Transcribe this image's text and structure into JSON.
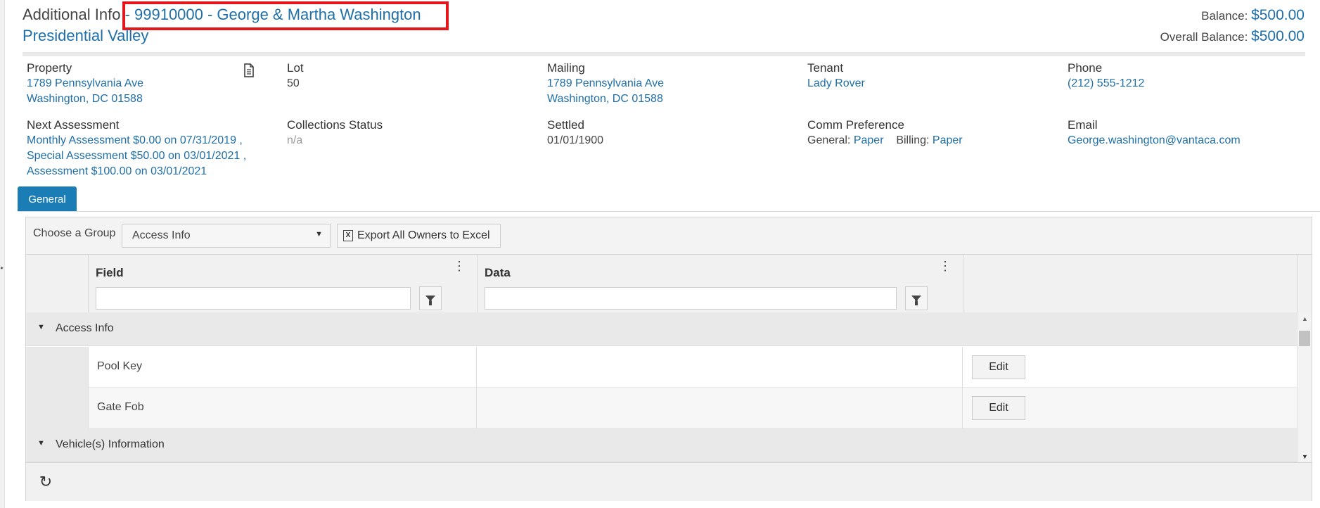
{
  "header": {
    "title_prefix": "Additional Info",
    "owner": "- 99910000 - George & Martha Washington",
    "community": "Presidential Valley",
    "balance_label": "Balance:",
    "balance_value": "$500.00",
    "overall_label": "Overall Balance:",
    "overall_value": "$500.00"
  },
  "info": {
    "property": {
      "label": "Property",
      "line1": "1789 Pennsylvania Ave",
      "line2": "Washington, DC 01588"
    },
    "lot": {
      "label": "Lot",
      "value": "50"
    },
    "mailing": {
      "label": "Mailing",
      "line1": "1789 Pennsylvania Ave",
      "line2": "Washington, DC 01588"
    },
    "tenant": {
      "label": "Tenant",
      "value": "Lady Rover"
    },
    "phone": {
      "label": "Phone",
      "value": "(212) 555-1212"
    },
    "next_assessment": {
      "label": "Next Assessment",
      "line1": "Monthly Assessment $0.00 on 07/31/2019 ,",
      "line2": "Special Assessment $50.00 on 03/01/2021 ,",
      "line3": "Assessment $100.00 on 03/01/2021"
    },
    "collections": {
      "label": "Collections Status",
      "value": "n/a"
    },
    "settled": {
      "label": "Settled",
      "value": "01/01/1900"
    },
    "comm": {
      "label": "Comm Preference",
      "general_label": "General:",
      "general_value": "Paper",
      "billing_label": "Billing:",
      "billing_value": "Paper"
    },
    "email": {
      "label": "Email",
      "value": "George.washington@vantaca.com"
    }
  },
  "tabs": [
    {
      "label": "General"
    }
  ],
  "toolbar": {
    "group_label": "Choose a Group",
    "group_value": "Access Info",
    "export_label": "Export All Owners to Excel",
    "export_icon_letter": "X"
  },
  "grid": {
    "columns": [
      {
        "label": "Field"
      },
      {
        "label": "Data"
      }
    ],
    "groups": [
      {
        "label": "Access Info",
        "rows": [
          {
            "field": "Pool Key",
            "data": "",
            "action": "Edit"
          },
          {
            "field": "Gate Fob",
            "data": "",
            "action": "Edit"
          }
        ]
      },
      {
        "label": "Vehicle(s) Information",
        "rows": []
      }
    ]
  },
  "colors": {
    "accent": "#1e6fa8",
    "tab": "#1a7db5",
    "highlight": "#e3161c"
  }
}
